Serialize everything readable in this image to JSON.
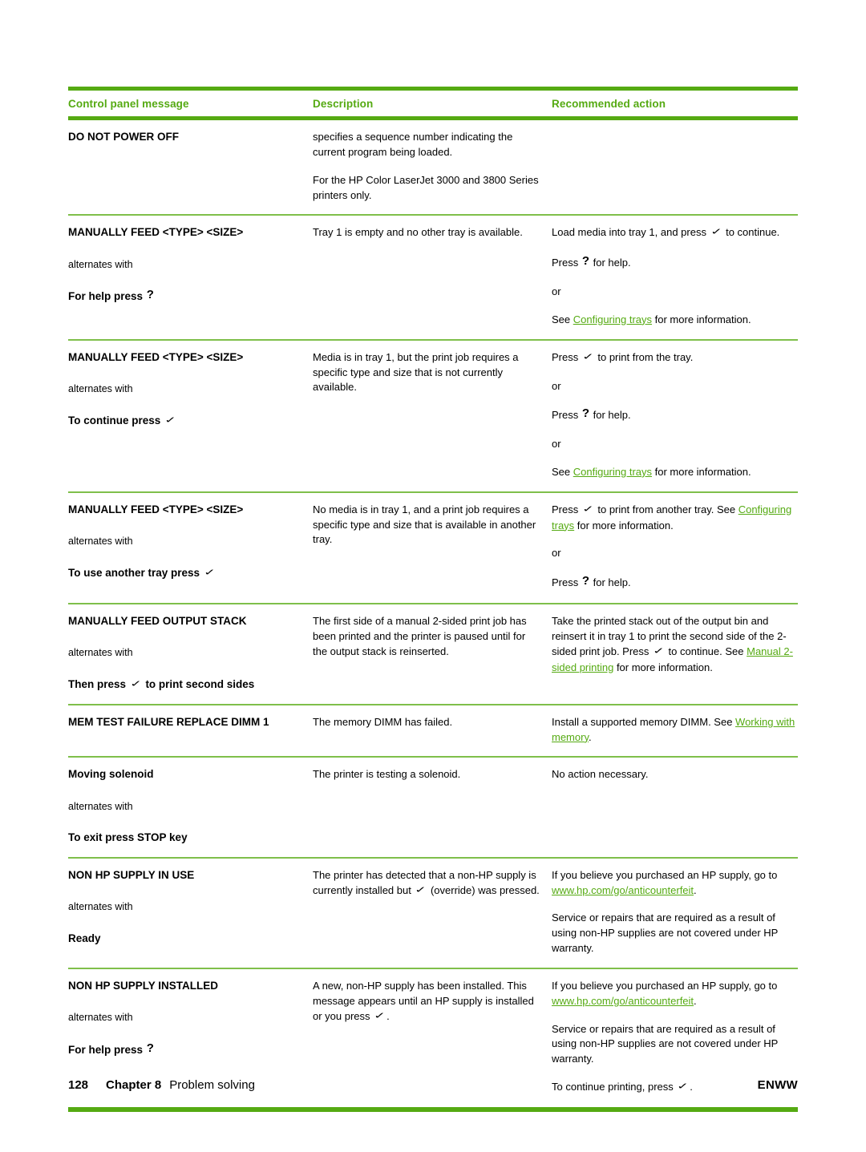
{
  "colors": {
    "accent_green": "#55aa12",
    "rule_thin_green": "#7fbf4a",
    "text": "#000000"
  },
  "table": {
    "headers": {
      "col1": "Control panel message",
      "col2": "Description",
      "col3": "Recommended action"
    },
    "rows": [
      {
        "message": "DO NOT POWER OFF",
        "alternates_label": "",
        "message_alt": "",
        "description": [
          "specifies a sequence number indicating the current program being loaded.",
          "For the HP Color LaserJet 3000 and 3800 Series printers only."
        ],
        "action": []
      },
      {
        "message": "MANUALLY FEED <TYPE> <SIZE>",
        "alternates_label": "alternates with",
        "message_alt": "For help press",
        "message_alt_glyph": "?",
        "description": [
          "Tray 1 is empty and no other tray is available."
        ],
        "action": [
          "Load media into tray 1, and press ✓ to continue.",
          "Press ? for help.",
          "or",
          "See Configuring trays for more information."
        ],
        "action_link": "Configuring trays"
      },
      {
        "message": "MANUALLY FEED <TYPE> <SIZE>",
        "alternates_label": "alternates with",
        "message_alt": "To continue press",
        "message_alt_glyph": "✓",
        "description": [
          "Media is in tray 1, but the print job requires a specific type and size that is not currently available."
        ],
        "action": [
          "Press ✓ to print from the tray.",
          "or",
          "Press ? for help.",
          "or",
          "See Configuring trays for more information."
        ],
        "action_link": "Configuring trays"
      },
      {
        "message": "MANUALLY FEED <TYPE> <SIZE>",
        "alternates_label": "alternates with",
        "message_alt": "To use another tray press",
        "message_alt_glyph": "✓",
        "description": [
          "No media is in tray 1, and a print job requires a specific type and size that is available in another tray."
        ],
        "action": [
          "Press ✓ to print from another tray. See Configuring trays for more information.",
          "or",
          "Press ? for help."
        ],
        "action_link": "Configuring trays"
      },
      {
        "message": "MANUALLY FEED OUTPUT STACK",
        "alternates_label": "alternates with",
        "message_alt": "Then press ✓ to print second sides",
        "description": [
          "The first side of a manual 2-sided print job has been printed and the printer is paused until for the output stack is reinserted."
        ],
        "action": [
          "Take the printed stack out of the output bin and reinsert it in tray 1 to print the second side of the 2-sided print job. Press ✓ to continue. See Manual 2-sided printing for more information."
        ],
        "action_link": "Manual 2-sided printing"
      },
      {
        "message": "MEM TEST FAILURE REPLACE DIMM 1",
        "alternates_label": "",
        "message_alt": "",
        "description": [
          "The memory DIMM has failed."
        ],
        "action": [
          "Install a supported memory DIMM. See Working with memory."
        ],
        "action_link": "Working with memory"
      },
      {
        "message": "Moving solenoid",
        "alternates_label": "alternates with",
        "message_alt": "To exit press STOP key",
        "description": [
          "The printer is testing a solenoid."
        ],
        "action": [
          "No action necessary."
        ]
      },
      {
        "message": "NON HP SUPPLY IN USE",
        "alternates_label": "alternates with",
        "message_alt": "Ready",
        "description": [
          "The printer has detected that a non-HP supply is currently installed but ✓ (override) was pressed."
        ],
        "action": [
          "If you believe you purchased an HP supply, go to www.hp.com/go/anticounterfeit.",
          "Service or repairs that are required as a result of using non-HP supplies are not covered under HP warranty."
        ],
        "action_link": "www.hp.com/go/anticounterfeit"
      },
      {
        "message": "NON HP SUPPLY INSTALLED",
        "alternates_label": "alternates with",
        "message_alt": "For help press",
        "message_alt_glyph": "?",
        "description": [
          "A new, non-HP supply has been installed. This message appears until an HP supply is installed or you press ✓."
        ],
        "action": [
          "If you believe you purchased an HP supply, go to www.hp.com/go/anticounterfeit.",
          "Service or repairs that are required as a result of using non-HP supplies are not covered under HP warranty.",
          "To continue printing, press ✓."
        ],
        "action_link": "www.hp.com/go/anticounterfeit"
      }
    ]
  },
  "footer": {
    "page_number": "128",
    "chapter": "Chapter 8",
    "section": "Problem solving",
    "locale": "ENWW"
  }
}
